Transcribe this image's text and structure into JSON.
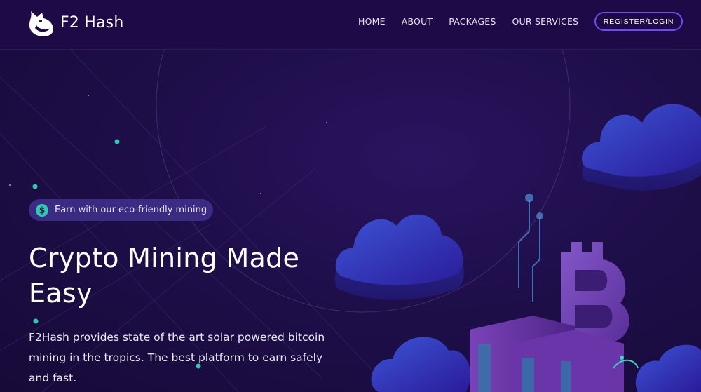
{
  "nav": {
    "brand": "F2 Hash",
    "links": [
      "HOME",
      "ABOUT",
      "PACKAGES",
      "OUR SERVICES"
    ],
    "register_label": "REGISTER/LOGIN"
  },
  "hero": {
    "badge_icon": "dollar-coin-icon",
    "badge_icon_glyph": "$",
    "badge_text": "Earn with our eco-friendly mining",
    "title": "Crypto Mining Made Easy",
    "description": "F2Hash provides state of the art solar powered bitcoin mining in the tropics. The best platform to earn safely and fast."
  },
  "colors": {
    "background": "#1c0c43",
    "accent": "#6d4cf0",
    "badge": "#3b2b83",
    "teal": "#33c7b3"
  }
}
